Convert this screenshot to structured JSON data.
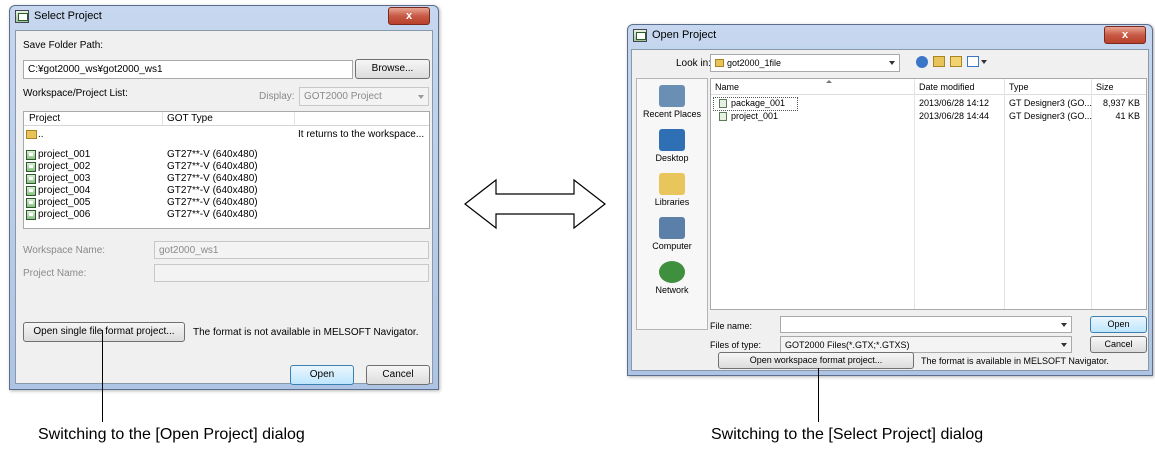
{
  "select_project": {
    "title": "Select Project",
    "close_label": "x",
    "save_folder_label": "Save Folder Path:",
    "save_folder_value": "C:¥got2000_ws¥got2000_ws1",
    "browse_label": "Browse...",
    "workspace_list_label": "Workspace/Project List:",
    "display_label": "Display:",
    "display_value": "GOT2000 Project",
    "columns": [
      "Project",
      "GOT Type"
    ],
    "rows": [
      {
        "project": "..",
        "got_type": "",
        "note": "It returns to the workspace...",
        "icon": "folder-up-icon"
      },
      {
        "project": "project_001",
        "got_type": "GT27**-V (640x480)",
        "note": "",
        "icon": "project-icon"
      },
      {
        "project": "project_002",
        "got_type": "GT27**-V (640x480)",
        "note": "",
        "icon": "project-icon"
      },
      {
        "project": "project_003",
        "got_type": "GT27**-V (640x480)",
        "note": "",
        "icon": "project-icon"
      },
      {
        "project": "project_004",
        "got_type": "GT27**-V (640x480)",
        "note": "",
        "icon": "project-icon"
      },
      {
        "project": "project_005",
        "got_type": "GT27**-V (640x480)",
        "note": "",
        "icon": "project-icon"
      },
      {
        "project": "project_006",
        "got_type": "GT27**-V (640x480)",
        "note": "",
        "icon": "project-icon"
      }
    ],
    "workspace_name_label": "Workspace Name:",
    "workspace_name_value": "got2000_ws1",
    "project_name_label": "Project Name:",
    "project_name_value": "",
    "single_file_button": "Open single file format project...",
    "format_note": "The format is not available in MELSOFT Navigator.",
    "open_label": "Open",
    "cancel_label": "Cancel"
  },
  "open_project": {
    "title": "Open Project",
    "close_label": "x",
    "look_in_label": "Look in:",
    "look_in_value": "got2000_1file",
    "places": [
      {
        "label": "Recent Places",
        "icon": "recent-places-icon"
      },
      {
        "label": "Desktop",
        "icon": "desktop-icon"
      },
      {
        "label": "Libraries",
        "icon": "libraries-icon"
      },
      {
        "label": "Computer",
        "icon": "computer-icon"
      },
      {
        "label": "Network",
        "icon": "network-icon"
      }
    ],
    "columns": [
      "Name",
      "Date modified",
      "Type",
      "Size"
    ],
    "files": [
      {
        "name": "package_001",
        "date": "2013/06/28 14:12",
        "type": "GT Designer3 (GO...",
        "size": "8,937 KB"
      },
      {
        "name": "project_001",
        "date": "2013/06/28 14:44",
        "type": "GT Designer3 (GO...",
        "size": "41 KB"
      }
    ],
    "file_name_label": "File name:",
    "file_name_value": "",
    "files_of_type_label": "Files of type:",
    "files_of_type_value": "GOT2000 Files(*.GTX;*.GTXS)",
    "open_label": "Open",
    "cancel_label": "Cancel",
    "workspace_button": "Open workspace format project...",
    "format_note": "The format is available in MELSOFT Navigator."
  },
  "captions": {
    "left": "Switching to the [Open Project] dialog",
    "right": "Switching to the [Select Project] dialog"
  },
  "colors": {
    "title_bar": "#aec4e4",
    "close_button": "#c75a45",
    "dialog_body": "#f0f0f0",
    "default_button": "#bee6fd"
  }
}
